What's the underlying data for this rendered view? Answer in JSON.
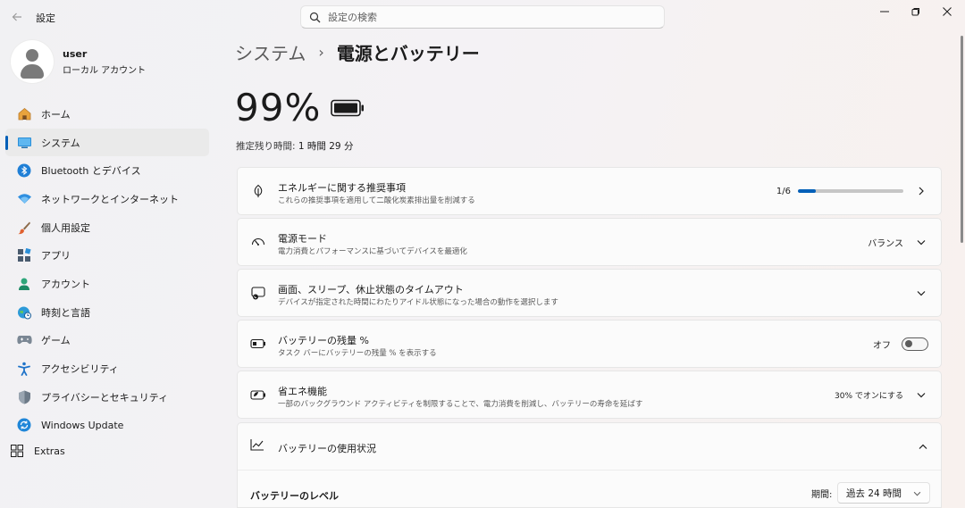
{
  "window": {
    "app_title": "設定",
    "search_placeholder": "設定の検索"
  },
  "profile": {
    "user_name": "user",
    "account_type": "ローカル アカウント"
  },
  "sidebar": {
    "items": [
      {
        "label": "ホーム",
        "icon": "home-icon"
      },
      {
        "label": "システム",
        "icon": "system-icon",
        "active": true
      },
      {
        "label": "Bluetooth とデバイス",
        "icon": "bluetooth-icon"
      },
      {
        "label": "ネットワークとインターネット",
        "icon": "network-icon"
      },
      {
        "label": "個人用設定",
        "icon": "brush-icon"
      },
      {
        "label": "アプリ",
        "icon": "apps-icon"
      },
      {
        "label": "アカウント",
        "icon": "account-icon"
      },
      {
        "label": "時刻と言語",
        "icon": "globe-clock-icon"
      },
      {
        "label": "ゲーム",
        "icon": "gamepad-icon"
      },
      {
        "label": "アクセシビリティ",
        "icon": "accessibility-icon"
      },
      {
        "label": "プライバシーとセキュリティ",
        "icon": "shield-icon"
      },
      {
        "label": "Windows Update",
        "icon": "update-icon"
      }
    ],
    "extras_label": "Extras"
  },
  "header": {
    "parent": "システム",
    "separator": "›",
    "current": "電源とバッテリー"
  },
  "battery": {
    "percent": "99%",
    "remaining_label": "推定残り時間:",
    "remaining_value": "1 時間 29 分"
  },
  "cards": {
    "energy": {
      "title": "エネルギーに関する推奨事項",
      "subtitle": "これらの推奨事項を適用して二酸化炭素排出量を削減する",
      "progress_text": "1/6",
      "progress_fraction": 0.1667
    },
    "power_mode": {
      "title": "電源モード",
      "subtitle": "電力消費とパフォーマンスに基づいてデバイスを最適化",
      "value": "バランス"
    },
    "screen_sleep": {
      "title": "画面、スリープ、休止状態のタイムアウト",
      "subtitle": "デバイスが指定された時間にわたりアイドル状態になった場合の動作を選択します"
    },
    "battery_pct": {
      "title": "バッテリーの残量 %",
      "subtitle": "タスク バーにバッテリーの残量 % を表示する",
      "toggle_label": "オフ",
      "toggle_on": false
    },
    "saver": {
      "title": "省エネ機能",
      "subtitle": "一部のバックグラウンド アクティビティを制限することで、電力消費を削減し、バッテリーの寿命を延ばす",
      "value": "30% でオンにする"
    },
    "usage": {
      "title": "バッテリーの使用状況",
      "level_label": "バッテリーのレベル",
      "period_label": "期間:",
      "period_value": "過去 24 時間"
    }
  },
  "colors": {
    "accent": "#005fb8"
  }
}
